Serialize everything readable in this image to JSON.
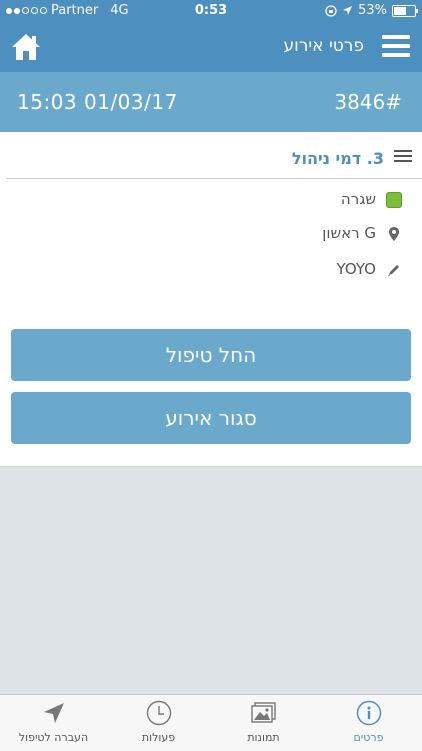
{
  "status_bar": {
    "carrier": "Partner",
    "network": "4G",
    "time": "0:53",
    "battery": "53%",
    "battery_level": 0.53
  },
  "nav": {
    "title": "פרטי אירוע",
    "home_icon": "home-icon",
    "menu_icon": "hamburger-menu-icon"
  },
  "event": {
    "datetime": "15:03 01/03/17",
    "number": "3846#"
  },
  "details": {
    "heading": "3. דמי ניהול",
    "status": "שגרה",
    "status_color": "#7cbf3b",
    "location": "G ראשון",
    "note": "YOYO"
  },
  "actions": {
    "start_treatment": "החל טיפול",
    "close_event": "סגור אירוע"
  },
  "tabs": [
    {
      "label": "פרטים",
      "icon": "info-icon"
    },
    {
      "label": "תמונות",
      "icon": "photos-icon"
    },
    {
      "label": "פעולות",
      "icon": "clock-icon"
    },
    {
      "label": "העברה לטיפול",
      "icon": "send-icon"
    }
  ]
}
